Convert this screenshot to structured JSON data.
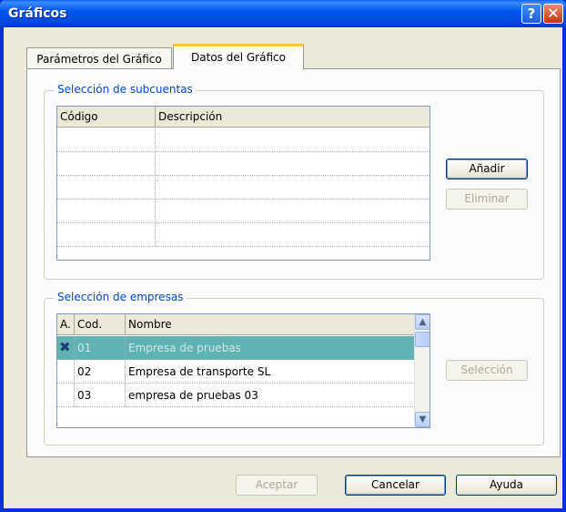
{
  "window": {
    "title": "Gráficos"
  },
  "titlebar": {
    "help_icon": "question-icon",
    "close_icon": "close-icon"
  },
  "tabs": [
    {
      "label": "Parámetros del Gráfico",
      "active": false
    },
    {
      "label": "Datos del Gráfico",
      "active": true
    }
  ],
  "subcuentas": {
    "legend": "Selección de subcuentas",
    "columns": [
      "Código",
      "Descripción"
    ],
    "rows": [
      [
        "",
        ""
      ],
      [
        "",
        ""
      ],
      [
        "",
        ""
      ],
      [
        "",
        ""
      ],
      [
        "",
        ""
      ]
    ],
    "add_label": "Añadir",
    "remove_label": "Eliminar"
  },
  "empresas": {
    "legend": "Selección de empresas",
    "columns": [
      "A.",
      "Cod.",
      "Nombre"
    ],
    "rows": [
      {
        "active": true,
        "code": "01",
        "name": "Empresa de pruebas",
        "selected": true
      },
      {
        "active": false,
        "code": "02",
        "name": "Empresa de transporte SL",
        "selected": false
      },
      {
        "active": false,
        "code": "03",
        "name": "empresa de pruebas 03",
        "selected": false
      }
    ],
    "selection_label": "Selección",
    "active_icon": "x-mark-icon"
  },
  "footer": {
    "accept_label": "Aceptar",
    "cancel_label": "Cancelar",
    "help_label": "Ayuda"
  }
}
